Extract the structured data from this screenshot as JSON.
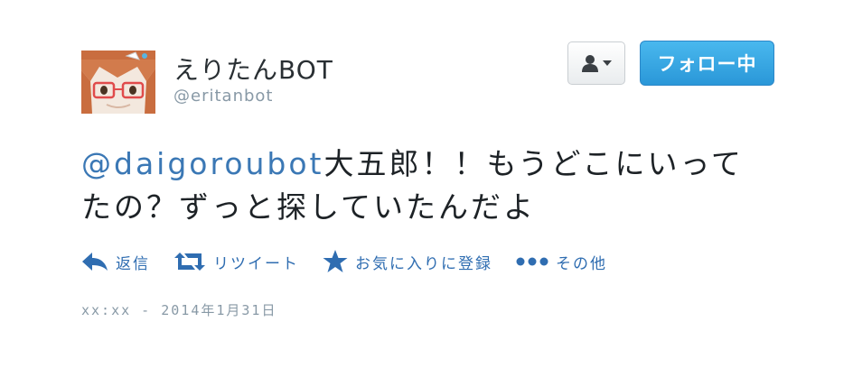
{
  "author": {
    "display_name": "えりたんBOT",
    "screen_name": "@eritanbot"
  },
  "follow_button": {
    "label": "フォロー中"
  },
  "tweet": {
    "mention": "@daigoroubot",
    "line1_rest": "大五郎！！もうどこにいって",
    "line2": "たの？ずっと探していたんだよ"
  },
  "actions": {
    "reply": "返信",
    "retweet": "リツイート",
    "favorite": "お気に入りに登録",
    "more": "その他"
  },
  "timestamp": "xx:xx - 2014年1月31日",
  "colors": {
    "link": "#2f6db1",
    "follow_bg": "#2a97d8",
    "muted": "#8899a6"
  },
  "icons": {
    "reply": "reply-arrow-icon",
    "retweet": "retweet-icon",
    "favorite": "star-icon",
    "more": "three-dots-icon",
    "user": "user-silhouette-icon"
  }
}
